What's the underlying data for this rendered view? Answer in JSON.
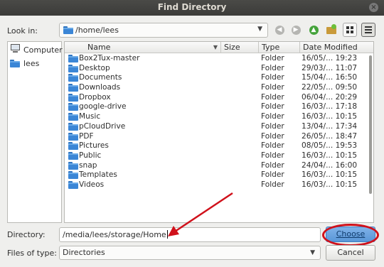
{
  "window": {
    "title": "Find Directory",
    "close_glyph": "×"
  },
  "lookin": {
    "label": "Look in:",
    "path": "/home/lees"
  },
  "toolbar": {
    "back_icon": "back-icon",
    "forward_icon": "forward-icon",
    "up_icon": "up-arrow-icon",
    "new_folder_icon": "new-folder-icon",
    "list_view_icon": "list-view-icon",
    "detail_view_icon": "detail-view-icon"
  },
  "sidebar": {
    "items": [
      {
        "label": "Computer",
        "icon": "computer-icon"
      },
      {
        "label": "lees",
        "icon": "folder-icon"
      }
    ]
  },
  "columns": [
    "Name",
    "Size",
    "Type",
    "Date Modified"
  ],
  "files": [
    {
      "name": "Box2Tux-master",
      "size": "",
      "type": "Folder",
      "date": "16/05/... 19:23"
    },
    {
      "name": "Desktop",
      "size": "",
      "type": "Folder",
      "date": "29/03/... 11:07"
    },
    {
      "name": "Documents",
      "size": "",
      "type": "Folder",
      "date": "15/04/... 16:50"
    },
    {
      "name": "Downloads",
      "size": "",
      "type": "Folder",
      "date": "22/05/... 09:50"
    },
    {
      "name": "Dropbox",
      "size": "",
      "type": "Folder",
      "date": "06/04/... 20:29"
    },
    {
      "name": "google-drive",
      "size": "",
      "type": "Folder",
      "date": "16/03/... 17:18"
    },
    {
      "name": "Music",
      "size": "",
      "type": "Folder",
      "date": "16/03/... 10:15"
    },
    {
      "name": "pCloudDrive",
      "size": "",
      "type": "Folder",
      "date": "13/04/... 17:34"
    },
    {
      "name": "PDF",
      "size": "",
      "type": "Folder",
      "date": "26/05/... 18:47"
    },
    {
      "name": "Pictures",
      "size": "",
      "type": "Folder",
      "date": "08/05/... 19:53"
    },
    {
      "name": "Public",
      "size": "",
      "type": "Folder",
      "date": "16/03/... 10:15"
    },
    {
      "name": "snap",
      "size": "",
      "type": "Folder",
      "date": "24/04/... 16:00"
    },
    {
      "name": "Templates",
      "size": "",
      "type": "Folder",
      "date": "16/03/... 10:15"
    },
    {
      "name": "Videos",
      "size": "",
      "type": "Folder",
      "date": "16/03/... 10:15"
    }
  ],
  "directory": {
    "label": "Directory:",
    "value": "/media/lees/storage/Home"
  },
  "filetypes": {
    "label": "Files of type:",
    "value": "Directories"
  },
  "buttons": {
    "choose": "Choose",
    "cancel": "Cancel"
  },
  "colors": {
    "accent": "#5a97d8",
    "annotation": "#d0111b",
    "folder": "#3b86d6"
  }
}
